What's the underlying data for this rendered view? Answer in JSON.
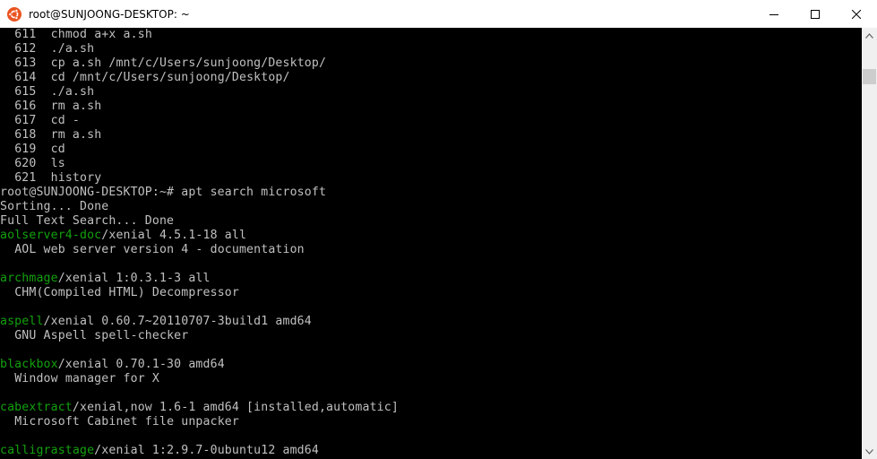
{
  "window": {
    "title": "root@SUNJOONG-DESKTOP: ~"
  },
  "icons": {
    "app": "ubuntu-icon",
    "minimize": "minimize-icon",
    "maximize": "maximize-icon",
    "close": "close-icon",
    "scroll_up": "chevron-up-icon",
    "scroll_down": "chevron-down-icon"
  },
  "colors": {
    "terminal_bg": "#000000",
    "terminal_fg": "#c0c0c0",
    "package_name": "#13a10e",
    "ubuntu_orange": "#e95420"
  },
  "terminal": {
    "history": [
      {
        "num": "611",
        "cmd": "chmod a+x a.sh"
      },
      {
        "num": "612",
        "cmd": "./a.sh"
      },
      {
        "num": "613",
        "cmd": "cp a.sh /mnt/c/Users/sunjoong/Desktop/"
      },
      {
        "num": "614",
        "cmd": "cd /mnt/c/Users/sunjoong/Desktop/"
      },
      {
        "num": "615",
        "cmd": "./a.sh"
      },
      {
        "num": "616",
        "cmd": "rm a.sh"
      },
      {
        "num": "617",
        "cmd": "cd -"
      },
      {
        "num": "618",
        "cmd": "rm a.sh"
      },
      {
        "num": "619",
        "cmd": "cd"
      },
      {
        "num": "620",
        "cmd": "ls"
      },
      {
        "num": "621",
        "cmd": "history"
      }
    ],
    "prompt": "root@SUNJOONG-DESKTOP:~# apt search microsoft",
    "sorting": "Sorting... Done",
    "fulltext": "Full Text Search... Done",
    "packages": [
      {
        "name": "aolserver4-doc",
        "info": "/xenial 4.5.1-18 all",
        "desc": "AOL web server version 4 - documentation"
      },
      {
        "name": "archmage",
        "info": "/xenial 1:0.3.1-3 all",
        "desc": "CHM(Compiled HTML) Decompressor"
      },
      {
        "name": "aspell",
        "info": "/xenial 0.60.7~20110707-3build1 amd64",
        "desc": "GNU Aspell spell-checker"
      },
      {
        "name": "blackbox",
        "info": "/xenial 0.70.1-30 amd64",
        "desc": "Window manager for X"
      },
      {
        "name": "cabextract",
        "info": "/xenial,now 1.6-1 amd64 [installed,automatic]",
        "desc": "Microsoft Cabinet file unpacker"
      },
      {
        "name": "calligrastage",
        "info": "/xenial 1:2.9.7-0ubuntu12 amd64",
        "desc": ""
      }
    ]
  }
}
